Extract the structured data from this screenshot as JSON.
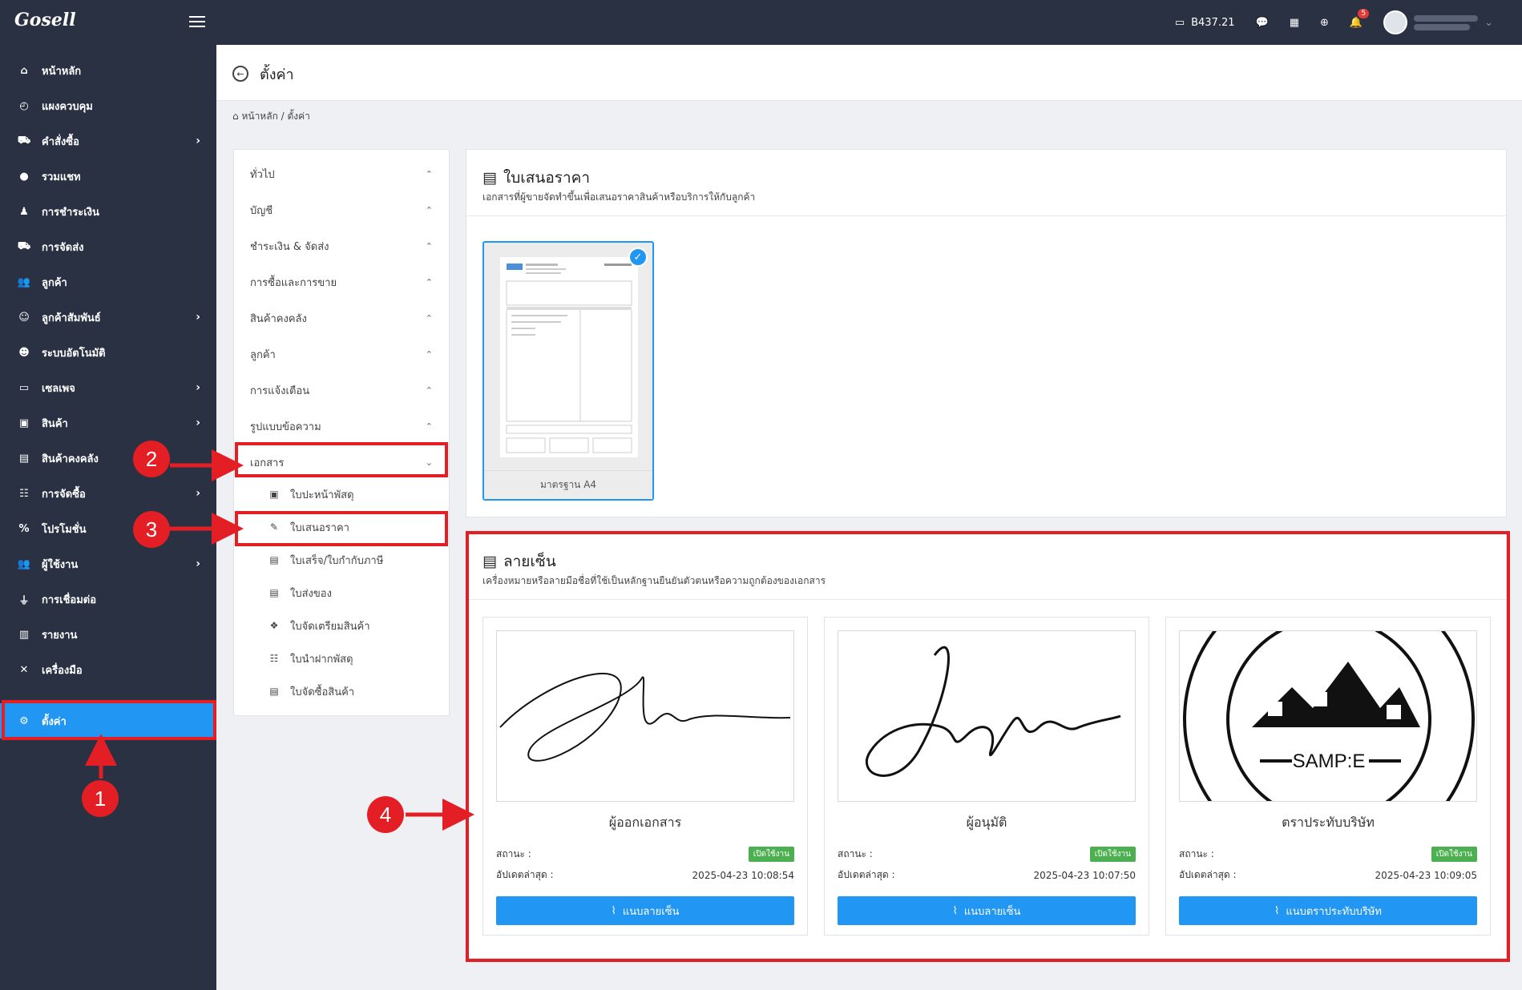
{
  "app": {
    "logo": "Gosell"
  },
  "topbar": {
    "balance": "B437.21",
    "notifications_count": "5"
  },
  "sidebar": {
    "items": [
      {
        "label": "หน้าหลัก",
        "icon": "home-icon"
      },
      {
        "label": "แผงควบคุม",
        "icon": "dashboard-icon"
      },
      {
        "label": "คำสั่งซื้อ",
        "icon": "cart-icon"
      },
      {
        "label": "รวมแชท",
        "icon": "chat-icon"
      },
      {
        "label": "การชำระเงิน",
        "icon": "payment-icon"
      },
      {
        "label": "การจัดส่ง",
        "icon": "truck-icon"
      },
      {
        "label": "ลูกค้า",
        "icon": "users-icon"
      },
      {
        "label": "ลูกค้าสัมพันธ์",
        "icon": "crm-icon"
      },
      {
        "label": "ระบบอัตโนมัติ",
        "icon": "robot-icon"
      },
      {
        "label": "เซลเพจ",
        "icon": "salepage-icon"
      },
      {
        "label": "สินค้า",
        "icon": "product-icon"
      },
      {
        "label": "สินค้าคงคลัง",
        "icon": "warehouse-icon"
      },
      {
        "label": "การจัดซื้อ",
        "icon": "purchase-icon"
      },
      {
        "label": "โปรโมชั่น",
        "icon": "percent-icon"
      },
      {
        "label": "ผู้ใช้งาน",
        "icon": "user-group-icon"
      },
      {
        "label": "การเชื่อมต่อ",
        "icon": "plug-icon"
      },
      {
        "label": "รายงาน",
        "icon": "report-icon"
      },
      {
        "label": "เครื่องมือ",
        "icon": "tools-icon"
      },
      {
        "label": "ตั้งค่า",
        "icon": "gear-icon"
      }
    ]
  },
  "page": {
    "title": "ตั้งค่า",
    "breadcrumb": "หน้าหลัก / ตั้งค่า"
  },
  "settings_nav": {
    "sections": [
      "ทั่วไป",
      "บัญชี",
      "ชำระเงิน & จัดส่ง",
      "การซื้อและการขาย",
      "สินค้าคงคลัง",
      "ลูกค้า",
      "การแจ้งเตือน",
      "รูปแบบข้อความ",
      "เอกสาร"
    ],
    "documents": [
      "ใบปะหน้าพัสดุ",
      "ใบเสนอราคา",
      "ใบเสร็จ/ใบกำกับภาษี",
      "ใบส่งของ",
      "ใบจัดเตรียมสินค้า",
      "ใบนำฝากพัสดุ",
      "ใบจัดซื้อสินค้า"
    ]
  },
  "quotation": {
    "title": "ใบเสนอราคา",
    "subtitle": "เอกสารที่ผู้ขายจัดทำขึ้นเพื่อเสนอราคาสินค้าหรือบริการให้กับลูกค้า",
    "template_label": "มาตรฐาน A4"
  },
  "signature": {
    "title": "ลายเซ็น",
    "subtitle": "เครื่องหมายหรือลายมือชื่อที่ใช้เป็นหลักฐานยืนยันตัวตนหรือความถูกต้องของเอกสาร",
    "status_label": "สถานะ :",
    "updated_label": "อัปเดตล่าสุด :",
    "cards": [
      {
        "name": "ผู้ออกเอกสาร",
        "status": "เปิดใช้งาน",
        "updated": "2025-04-23 10:08:54",
        "button": "แนบลายเซ็น"
      },
      {
        "name": "ผู้อนุมัติ",
        "status": "เปิดใช้งาน",
        "updated": "2025-04-23 10:07:50",
        "button": "แนบลายเซ็น"
      },
      {
        "name": "ตราประทับบริษัท",
        "status": "เปิดใช้งาน",
        "updated": "2025-04-23 10:09:05",
        "button": "แนบตราประทับบริษัท"
      }
    ],
    "stamp_text": "SAMP:E"
  },
  "annotations": [
    "1",
    "2",
    "3",
    "4"
  ],
  "colors": {
    "sidebar": "#2a3142",
    "accent": "#2196f3",
    "annotation": "#e31e24",
    "status_on": "#4caf50"
  }
}
